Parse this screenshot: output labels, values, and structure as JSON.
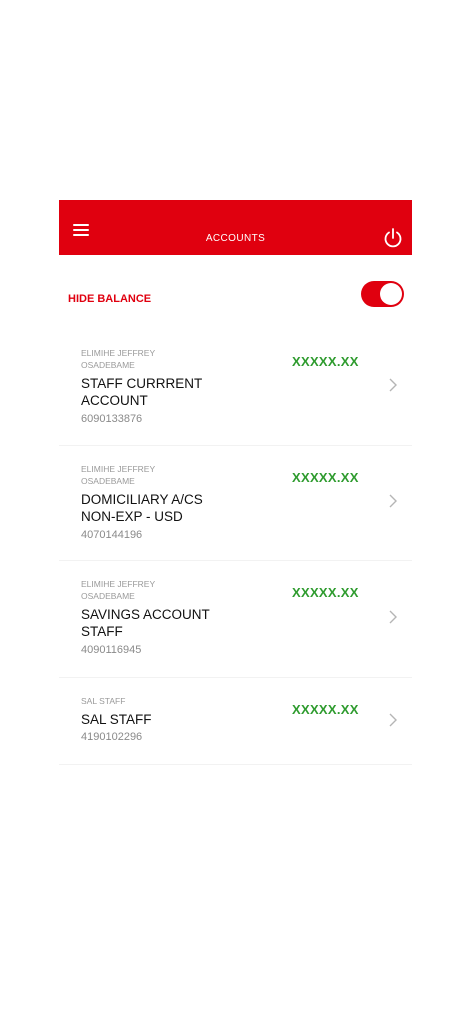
{
  "header": {
    "title": "ACCOUNTS",
    "menu_icon": "hamburger-menu-icon",
    "power_icon": "power-icon",
    "color": "#e0000f"
  },
  "hide_balance": {
    "label": "HIDE BALANCE",
    "enabled": true
  },
  "accounts": [
    {
      "holder": "ELIMIHE JEFFREY OSADEBAME",
      "name": "STAFF CURRRENT ACCOUNT",
      "number": "6090133876",
      "balance": "XXXXX.XX"
    },
    {
      "holder": "ELIMIHE JEFFREY OSADEBAME",
      "name": "DOMICILIARY A/CS NON-EXP - USD",
      "number": "4070144196",
      "balance": "XXXXX.XX"
    },
    {
      "holder": "ELIMIHE JEFFREY OSADEBAME",
      "name": "SAVINGS ACCOUNT STAFF",
      "number": "4090116945",
      "balance": "XXXXX.XX"
    },
    {
      "holder": "SAL STAFF",
      "name": "SAL STAFF",
      "number": "4190102296",
      "balance": "XXXXX.XX"
    }
  ]
}
